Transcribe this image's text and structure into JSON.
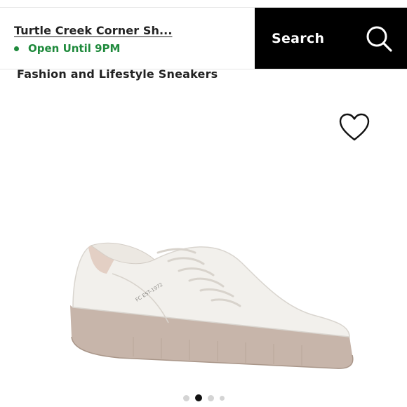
{
  "header": {
    "store_name": "Turtle Creek Corner Sh...",
    "store_status": "Open Until 9PM",
    "search_label": "Search"
  },
  "product": {
    "subtitle": "Fashion and Lifestyle Sneakers",
    "shoe_print": "FC EST-1972"
  },
  "carousel": {
    "total_images": 4,
    "active_index": 1
  },
  "icons": {
    "search": "search-icon",
    "favorite": "heart-outline-icon",
    "status": "status-dot-icon"
  },
  "colors": {
    "status_green": "#1f8a3c",
    "search_bg": "#000000",
    "sole_color": "#c7b5aa"
  }
}
